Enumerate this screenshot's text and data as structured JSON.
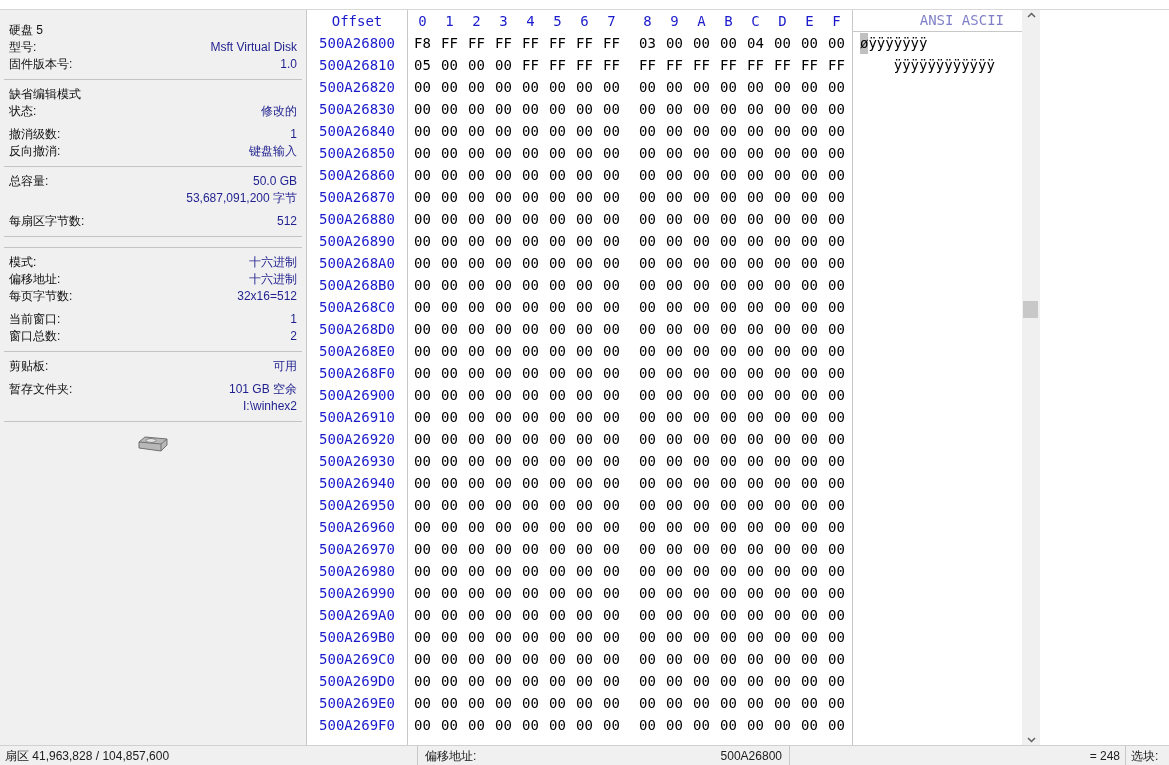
{
  "info_panel": {
    "sections": [
      {
        "groups": [
          [
            {
              "kind": "heading",
              "label": "硬盘 5"
            },
            {
              "kind": "pair",
              "label": "型号:",
              "values": [
                "Msft Virtual Disk"
              ]
            },
            {
              "kind": "pair",
              "label": "固件版本号:",
              "values": [
                "1.0"
              ]
            }
          ]
        ]
      },
      {
        "groups": [
          [
            {
              "kind": "heading",
              "label": "缺省编辑模式"
            },
            {
              "kind": "pair",
              "label": "状态:",
              "values": [
                "修改的"
              ]
            }
          ],
          [
            {
              "kind": "pair",
              "label": "撤消级数:",
              "values": [
                "1"
              ]
            },
            {
              "kind": "pair",
              "label": "反向撤消:",
              "values": [
                "键盘输入"
              ]
            }
          ]
        ]
      },
      {
        "groups": [
          [
            {
              "kind": "pair",
              "label": "总容量:",
              "values": [
                "50.0 GB",
                "53,687,091,200 字节"
              ]
            }
          ],
          [
            {
              "kind": "pair",
              "label": "每扇区字节数:",
              "values": [
                "512"
              ]
            }
          ]
        ]
      },
      {
        "kind": "spacer"
      },
      {
        "groups": [
          [
            {
              "kind": "pair",
              "label": "模式:",
              "values": [
                "十六进制"
              ]
            },
            {
              "kind": "pair",
              "label": "偏移地址:",
              "values": [
                "十六进制"
              ]
            },
            {
              "kind": "pair",
              "label": "每页字节数:",
              "values": [
                "32x16=512"
              ]
            }
          ],
          [
            {
              "kind": "pair",
              "label": "当前窗口:",
              "values": [
                "1"
              ]
            },
            {
              "kind": "pair",
              "label": "窗口总数:",
              "values": [
                "2"
              ]
            }
          ]
        ]
      },
      {
        "groups": [
          [
            {
              "kind": "pair",
              "label": "剪贴板:",
              "values": [
                "可用"
              ]
            }
          ],
          [
            {
              "kind": "pair",
              "label": "暂存文件夹:",
              "values": [
                "101 GB 空余",
                "I:\\winhex2"
              ]
            }
          ]
        ]
      }
    ]
  },
  "hex_view": {
    "header": {
      "offset": "Offset",
      "columns": [
        "0",
        "1",
        "2",
        "3",
        "4",
        "5",
        "6",
        "7",
        "8",
        "9",
        "A",
        "B",
        "C",
        "D",
        "E",
        "F"
      ],
      "ascii": "ANSI ASCII"
    },
    "rows": [
      {
        "offset": "500A26800",
        "bytes": [
          "F8",
          "FF",
          "FF",
          "FF",
          "FF",
          "FF",
          "FF",
          "FF",
          "03",
          "00",
          "00",
          "00",
          "04",
          "00",
          "00",
          "00"
        ],
        "ascii": [
          {
            "text": "ø",
            "selected": true
          },
          {
            "text": "ÿÿÿÿÿÿÿ",
            "selected": false
          }
        ]
      },
      {
        "offset": "500A26810",
        "bytes": [
          "05",
          "00",
          "00",
          "00",
          "FF",
          "FF",
          "FF",
          "FF",
          "FF",
          "FF",
          "FF",
          "FF",
          "FF",
          "FF",
          "FF",
          "FF"
        ],
        "ascii": [
          {
            "text": "    ÿÿÿÿÿÿÿÿÿÿÿÿ",
            "selected": false
          }
        ]
      },
      {
        "offset": "500A26820",
        "bytes": [
          "00",
          "00",
          "00",
          "00",
          "00",
          "00",
          "00",
          "00",
          "00",
          "00",
          "00",
          "00",
          "00",
          "00",
          "00",
          "00"
        ]
      },
      {
        "offset": "500A26830",
        "bytes": [
          "00",
          "00",
          "00",
          "00",
          "00",
          "00",
          "00",
          "00",
          "00",
          "00",
          "00",
          "00",
          "00",
          "00",
          "00",
          "00"
        ]
      },
      {
        "offset": "500A26840",
        "bytes": [
          "00",
          "00",
          "00",
          "00",
          "00",
          "00",
          "00",
          "00",
          "00",
          "00",
          "00",
          "00",
          "00",
          "00",
          "00",
          "00"
        ]
      },
      {
        "offset": "500A26850",
        "bytes": [
          "00",
          "00",
          "00",
          "00",
          "00",
          "00",
          "00",
          "00",
          "00",
          "00",
          "00",
          "00",
          "00",
          "00",
          "00",
          "00"
        ]
      },
      {
        "offset": "500A26860",
        "bytes": [
          "00",
          "00",
          "00",
          "00",
          "00",
          "00",
          "00",
          "00",
          "00",
          "00",
          "00",
          "00",
          "00",
          "00",
          "00",
          "00"
        ]
      },
      {
        "offset": "500A26870",
        "bytes": [
          "00",
          "00",
          "00",
          "00",
          "00",
          "00",
          "00",
          "00",
          "00",
          "00",
          "00",
          "00",
          "00",
          "00",
          "00",
          "00"
        ]
      },
      {
        "offset": "500A26880",
        "bytes": [
          "00",
          "00",
          "00",
          "00",
          "00",
          "00",
          "00",
          "00",
          "00",
          "00",
          "00",
          "00",
          "00",
          "00",
          "00",
          "00"
        ]
      },
      {
        "offset": "500A26890",
        "bytes": [
          "00",
          "00",
          "00",
          "00",
          "00",
          "00",
          "00",
          "00",
          "00",
          "00",
          "00",
          "00",
          "00",
          "00",
          "00",
          "00"
        ]
      },
      {
        "offset": "500A268A0",
        "bytes": [
          "00",
          "00",
          "00",
          "00",
          "00",
          "00",
          "00",
          "00",
          "00",
          "00",
          "00",
          "00",
          "00",
          "00",
          "00",
          "00"
        ]
      },
      {
        "offset": "500A268B0",
        "bytes": [
          "00",
          "00",
          "00",
          "00",
          "00",
          "00",
          "00",
          "00",
          "00",
          "00",
          "00",
          "00",
          "00",
          "00",
          "00",
          "00"
        ]
      },
      {
        "offset": "500A268C0",
        "bytes": [
          "00",
          "00",
          "00",
          "00",
          "00",
          "00",
          "00",
          "00",
          "00",
          "00",
          "00",
          "00",
          "00",
          "00",
          "00",
          "00"
        ]
      },
      {
        "offset": "500A268D0",
        "bytes": [
          "00",
          "00",
          "00",
          "00",
          "00",
          "00",
          "00",
          "00",
          "00",
          "00",
          "00",
          "00",
          "00",
          "00",
          "00",
          "00"
        ]
      },
      {
        "offset": "500A268E0",
        "bytes": [
          "00",
          "00",
          "00",
          "00",
          "00",
          "00",
          "00",
          "00",
          "00",
          "00",
          "00",
          "00",
          "00",
          "00",
          "00",
          "00"
        ]
      },
      {
        "offset": "500A268F0",
        "bytes": [
          "00",
          "00",
          "00",
          "00",
          "00",
          "00",
          "00",
          "00",
          "00",
          "00",
          "00",
          "00",
          "00",
          "00",
          "00",
          "00"
        ]
      },
      {
        "offset": "500A26900",
        "bytes": [
          "00",
          "00",
          "00",
          "00",
          "00",
          "00",
          "00",
          "00",
          "00",
          "00",
          "00",
          "00",
          "00",
          "00",
          "00",
          "00"
        ]
      },
      {
        "offset": "500A26910",
        "bytes": [
          "00",
          "00",
          "00",
          "00",
          "00",
          "00",
          "00",
          "00",
          "00",
          "00",
          "00",
          "00",
          "00",
          "00",
          "00",
          "00"
        ]
      },
      {
        "offset": "500A26920",
        "bytes": [
          "00",
          "00",
          "00",
          "00",
          "00",
          "00",
          "00",
          "00",
          "00",
          "00",
          "00",
          "00",
          "00",
          "00",
          "00",
          "00"
        ]
      },
      {
        "offset": "500A26930",
        "bytes": [
          "00",
          "00",
          "00",
          "00",
          "00",
          "00",
          "00",
          "00",
          "00",
          "00",
          "00",
          "00",
          "00",
          "00",
          "00",
          "00"
        ]
      },
      {
        "offset": "500A26940",
        "bytes": [
          "00",
          "00",
          "00",
          "00",
          "00",
          "00",
          "00",
          "00",
          "00",
          "00",
          "00",
          "00",
          "00",
          "00",
          "00",
          "00"
        ]
      },
      {
        "offset": "500A26950",
        "bytes": [
          "00",
          "00",
          "00",
          "00",
          "00",
          "00",
          "00",
          "00",
          "00",
          "00",
          "00",
          "00",
          "00",
          "00",
          "00",
          "00"
        ]
      },
      {
        "offset": "500A26960",
        "bytes": [
          "00",
          "00",
          "00",
          "00",
          "00",
          "00",
          "00",
          "00",
          "00",
          "00",
          "00",
          "00",
          "00",
          "00",
          "00",
          "00"
        ]
      },
      {
        "offset": "500A26970",
        "bytes": [
          "00",
          "00",
          "00",
          "00",
          "00",
          "00",
          "00",
          "00",
          "00",
          "00",
          "00",
          "00",
          "00",
          "00",
          "00",
          "00"
        ]
      },
      {
        "offset": "500A26980",
        "bytes": [
          "00",
          "00",
          "00",
          "00",
          "00",
          "00",
          "00",
          "00",
          "00",
          "00",
          "00",
          "00",
          "00",
          "00",
          "00",
          "00"
        ]
      },
      {
        "offset": "500A26990",
        "bytes": [
          "00",
          "00",
          "00",
          "00",
          "00",
          "00",
          "00",
          "00",
          "00",
          "00",
          "00",
          "00",
          "00",
          "00",
          "00",
          "00"
        ]
      },
      {
        "offset": "500A269A0",
        "bytes": [
          "00",
          "00",
          "00",
          "00",
          "00",
          "00",
          "00",
          "00",
          "00",
          "00",
          "00",
          "00",
          "00",
          "00",
          "00",
          "00"
        ]
      },
      {
        "offset": "500A269B0",
        "bytes": [
          "00",
          "00",
          "00",
          "00",
          "00",
          "00",
          "00",
          "00",
          "00",
          "00",
          "00",
          "00",
          "00",
          "00",
          "00",
          "00"
        ]
      },
      {
        "offset": "500A269C0",
        "bytes": [
          "00",
          "00",
          "00",
          "00",
          "00",
          "00",
          "00",
          "00",
          "00",
          "00",
          "00",
          "00",
          "00",
          "00",
          "00",
          "00"
        ]
      },
      {
        "offset": "500A269D0",
        "bytes": [
          "00",
          "00",
          "00",
          "00",
          "00",
          "00",
          "00",
          "00",
          "00",
          "00",
          "00",
          "00",
          "00",
          "00",
          "00",
          "00"
        ]
      },
      {
        "offset": "500A269E0",
        "bytes": [
          "00",
          "00",
          "00",
          "00",
          "00",
          "00",
          "00",
          "00",
          "00",
          "00",
          "00",
          "00",
          "00",
          "00",
          "00",
          "00"
        ]
      },
      {
        "offset": "500A269F0",
        "bytes": [
          "00",
          "00",
          "00",
          "00",
          "00",
          "00",
          "00",
          "00",
          "00",
          "00",
          "00",
          "00",
          "00",
          "00",
          "00",
          "00"
        ]
      }
    ]
  },
  "status_bar": {
    "sector": "扇区 41,963,828 / 104,857,600",
    "offset_label": "偏移地址:",
    "offset_value": "500A26800",
    "value": "= 248",
    "block_label": "选块:"
  }
}
